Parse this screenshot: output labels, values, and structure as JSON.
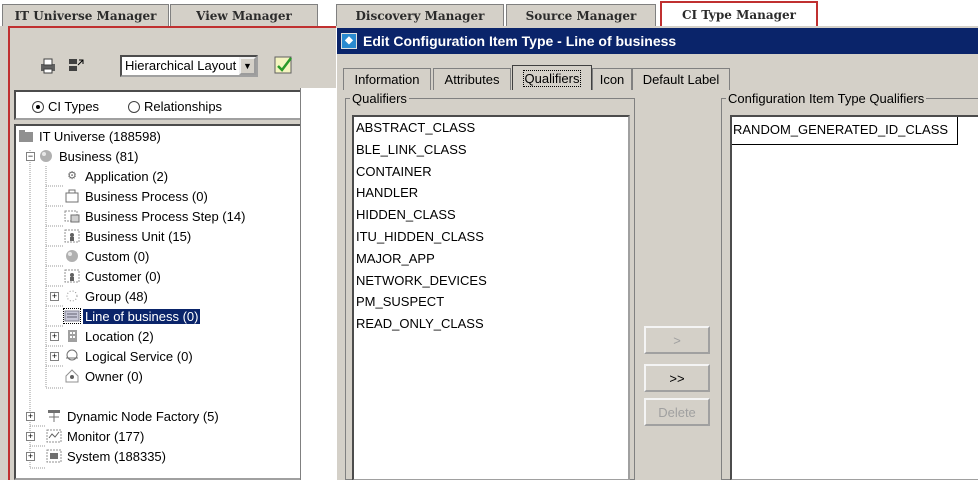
{
  "manager_tabs": [
    {
      "label": "IT Universe Manager"
    },
    {
      "label": "View Manager"
    },
    {
      "label": "Discovery Manager"
    },
    {
      "label": "Source Manager"
    },
    {
      "label": "CI Type Manager",
      "active": true
    }
  ],
  "toolbar": {
    "layout_select_value": "Hierarchical Layout",
    "icons": [
      "printer-icon",
      "export-icon",
      "layout-dropdown-arrow-icon",
      "apply-layout-icon"
    ]
  },
  "radio": {
    "ci_types_label": "CI Types",
    "relationships_label": "Relationships",
    "selected": "ci_types"
  },
  "tree": {
    "items": [
      {
        "label": "IT Universe (188598)",
        "icon": "folder-icon"
      },
      {
        "label": "Business (81)",
        "icon": "sphere-icon"
      },
      {
        "label": "Application (2)",
        "icon": "application-icon"
      },
      {
        "label": "Business Process (0)",
        "icon": "business-process-icon"
      },
      {
        "label": "Business Process Step (14)",
        "icon": "process-step-icon"
      },
      {
        "label": "Business Unit (15)",
        "icon": "business-unit-icon"
      },
      {
        "label": "Custom (0)",
        "icon": "sphere-icon"
      },
      {
        "label": "Customer (0)",
        "icon": "customer-icon"
      },
      {
        "label": "Group (48)",
        "icon": "group-icon"
      },
      {
        "label": "Line of business (0)",
        "icon": "line-of-business-icon"
      },
      {
        "label": "Location (2)",
        "icon": "location-icon"
      },
      {
        "label": "Logical Service (0)",
        "icon": "logical-service-icon"
      },
      {
        "label": "Owner (0)",
        "icon": "owner-icon"
      },
      {
        "label": "Dynamic Node Factory (5)",
        "icon": "node-factory-icon"
      },
      {
        "label": "Monitor (177)",
        "icon": "monitor-icon"
      },
      {
        "label": "System (188335)",
        "icon": "system-icon"
      }
    ]
  },
  "dialog": {
    "title": "Edit Configuration Item Type - Line of business",
    "tabs": [
      {
        "label": "Information"
      },
      {
        "label": "Attributes"
      },
      {
        "label": "Qualifiers",
        "active": true
      },
      {
        "label": "Icon"
      },
      {
        "label": "Default Label"
      }
    ],
    "qualifiers_legend": "Qualifiers",
    "ci_qualifiers_legend": "Configuration Item Type Qualifiers",
    "qualifiers": [
      "ABSTRACT_CLASS",
      "BLE_LINK_CLASS",
      "CONTAINER",
      "HANDLER",
      "HIDDEN_CLASS",
      "ITU_HIDDEN_CLASS",
      "MAJOR_APP",
      "NETWORK_DEVICES",
      "PM_SUSPECT",
      "READ_ONLY_CLASS"
    ],
    "ci_qualifiers": [
      "RANDOM_GENERATED_ID_CLASS"
    ],
    "buttons": {
      "add": ">",
      "add_all": ">>",
      "delete": "Delete"
    }
  }
}
